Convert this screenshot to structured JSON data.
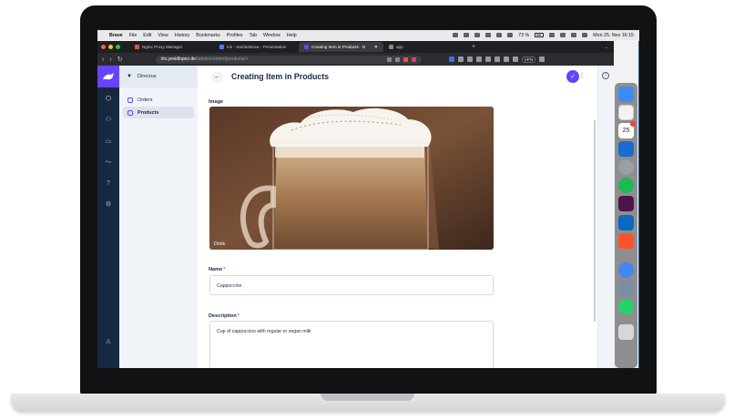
{
  "menubar": {
    "app_name": "Brave",
    "menus": [
      "File",
      "Edit",
      "View",
      "History",
      "Bookmarks",
      "Profiles",
      "Tab",
      "Window",
      "Help"
    ],
    "battery": "73 %",
    "clock": "Mon 25. Nov 16:15"
  },
  "browser": {
    "tabs": [
      {
        "label": "Nginx Proxy Manager",
        "color": "#e5533d"
      },
      {
        "label": "Iris - SambaNova - Presentation",
        "color": "#4f7cff"
      },
      {
        "label": "Creating Item in Products · D",
        "color": "#6644ff"
      },
      {
        "label": "app",
        "color": "#888888"
      }
    ],
    "new_tab": "+",
    "url_host": "iris.yesidlopez.de",
    "url_path": "/admin/content/products/+",
    "vpn": "VPN"
  },
  "directus": {
    "project_name": "Directus",
    "collections": [
      {
        "label": "Orders",
        "active": false
      },
      {
        "label": "Products",
        "active": true
      }
    ],
    "page_title": "Creating Item in Products",
    "accent": "#6644ff",
    "fields": {
      "image": {
        "label": "Image",
        "caption": "Drink"
      },
      "name": {
        "label": "Name",
        "required": "*",
        "value": "Cappuccino"
      },
      "description": {
        "label": "Description",
        "required": "*",
        "value": "Cup of cappuccino with regular or vegan milk"
      }
    }
  },
  "dock": {
    "calendar_day": "25"
  }
}
